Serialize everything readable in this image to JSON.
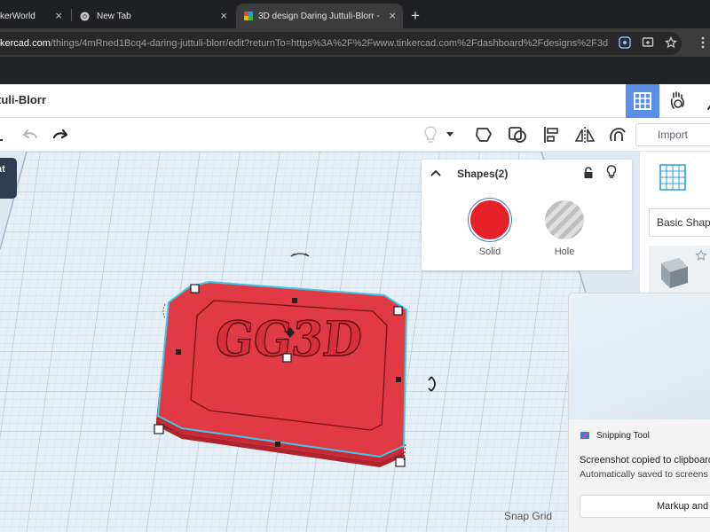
{
  "browser": {
    "tabs": [
      {
        "title": "kerWorld"
      },
      {
        "title": "New Tab"
      },
      {
        "title": "3D design Daring Juttuli-Blorr -"
      }
    ],
    "new_tab_glyph": "+",
    "close_glyph": "×",
    "url_host": "kercad.com",
    "url_path": "/things/4mRned1Bcq4-daring-juttuli-blorr/edit?returnTo=https%3A%2F%2Fwww.tinkercad.com%2Fdashboard%2Fdesigns%2F3d"
  },
  "header": {
    "design_name": "tuli-Blorr"
  },
  "toolbar": {
    "import_label": "Import"
  },
  "left_tab_text": "at",
  "inspector": {
    "title": "Shapes(2)",
    "solid_label": "Solid",
    "hole_label": "Hole",
    "solid_color": "#e8202a"
  },
  "right_panel": {
    "basic_shapes_label": "Basic Shap"
  },
  "workspace": {
    "snap_grid_label": "Snap Grid",
    "shape_text": "GG3D",
    "shape_color": "#e03a44",
    "selection_color": "#3ec7e6"
  },
  "notification": {
    "app_name": "Snipping Tool",
    "message": "Screenshot copied to clipboard",
    "sub_message": "Automatically saved to screens",
    "button_label": "Markup and"
  }
}
